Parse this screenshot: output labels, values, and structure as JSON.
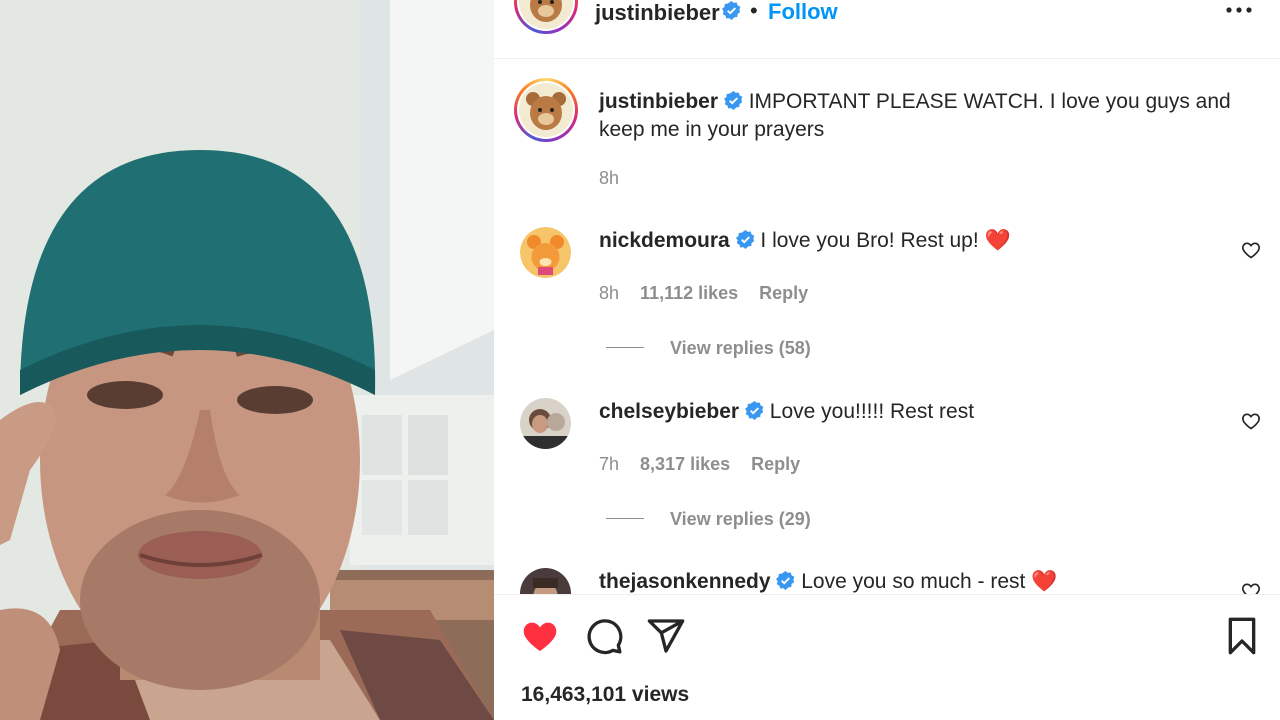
{
  "post": {
    "author": "justinbieber",
    "follow_label": "Follow",
    "separator": "•",
    "caption": "IMPORTANT PLEASE WATCH. I love you guys and keep me in your prayers",
    "time": "8h",
    "views": "16,463,101 views"
  },
  "comments": [
    {
      "username": "nickdemoura",
      "text": "I love you Bro! Rest up!",
      "emoji": "❤️",
      "time": "8h",
      "likes": "11,112 likes",
      "reply_label": "Reply",
      "view_replies": "View replies (58)"
    },
    {
      "username": "chelseybieber",
      "text": "Love you!!!!! Rest rest",
      "time": "7h",
      "likes": "8,317 likes",
      "reply_label": "Reply",
      "view_replies": "View replies (29)"
    },
    {
      "username": "thejasonkennedy",
      "text": "Love you so much - rest",
      "emoji": "❤️"
    }
  ],
  "icons": {
    "verified": "verified-badge-icon",
    "more": "more-options-icon",
    "like": "heart-filled-icon",
    "comment": "comment-icon",
    "share": "share-icon",
    "save": "bookmark-icon",
    "comment_like": "heart-outline-icon"
  },
  "colors": {
    "accent": "#0095f6",
    "like_red": "#ff3040",
    "secondary_text": "#8e8e8e",
    "verified_blue": "#3897f0"
  }
}
